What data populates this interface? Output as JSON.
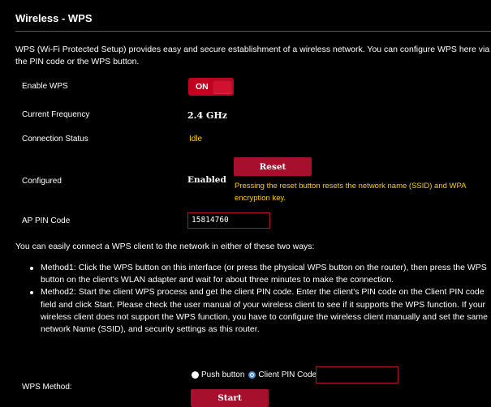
{
  "page": {
    "title": "Wireless - WPS",
    "intro": "WPS (Wi-Fi Protected Setup) provides easy and secure establishment of a wireless network. You can configure WPS here via the PIN code or the WPS button."
  },
  "settings": {
    "enable_wps": {
      "label": "Enable WPS",
      "value": "ON"
    },
    "current_frequency": {
      "label": "Current Frequency",
      "value": "2.4 GHz"
    },
    "connection_status": {
      "label": "Connection Status",
      "value": "Idle"
    },
    "configured": {
      "label": "Configured",
      "value": "Enabled",
      "reset_label": "Reset",
      "reset_note": "Pressing the reset button resets the network name (SSID) and WPA encryption key."
    },
    "ap_pin": {
      "label": "AP PIN Code",
      "value": "15814760"
    }
  },
  "methods": {
    "intro": "You can easily connect a WPS client to the network in either of these two ways:",
    "items": [
      "Method1: Click the WPS button on this interface (or press the physical WPS button on the router), then press the WPS button on the client's WLAN adapter and wait for about three minutes to make the connection.",
      "Method2: Start the client WPS process and get the client PIN code. Enter the client's PIN code on the Client PIN code field and click Start. Please check the user manual of your wireless client to see if it supports the WPS function. If your wireless client does not support the WPS function, you have to configure the wireless client manually and set the same network Name (SSID), and security settings as this router."
    ]
  },
  "wps_method": {
    "label": "WPS Method:",
    "options": [
      "Push button",
      "Client PIN Code"
    ],
    "selected": "Client PIN Code",
    "client_pin_value": "",
    "start_label": "Start"
  },
  "colors": {
    "background": "#000000",
    "accent_red": "#a6102c",
    "status_yellow": "#ffcc00",
    "radio_blue": "#4b90e2"
  }
}
